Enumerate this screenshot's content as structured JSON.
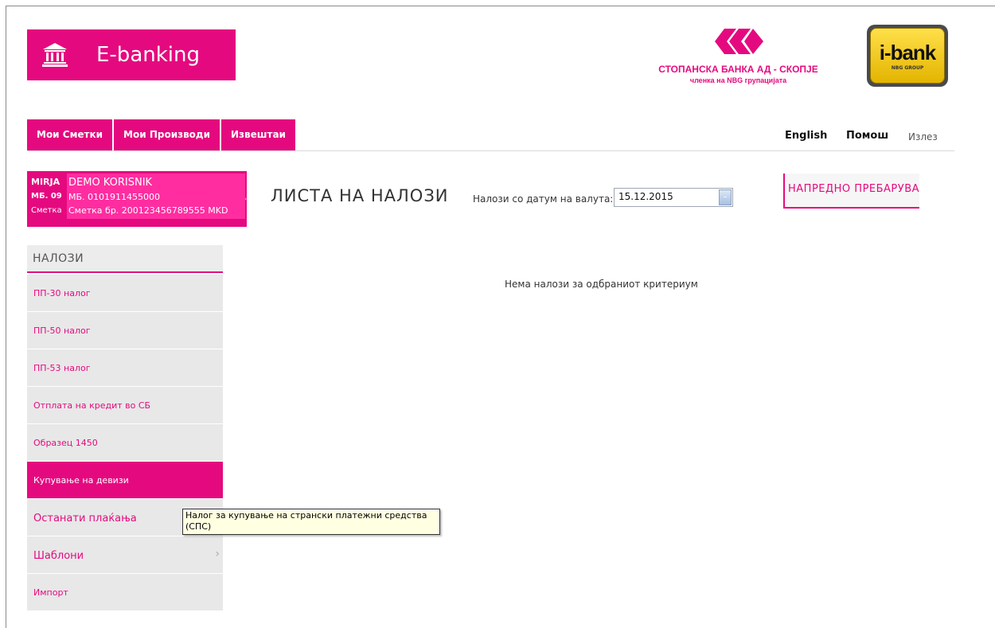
{
  "header": {
    "app_title": "E-banking",
    "bank_name": "СТОПАНСКА БАНКА АД - СКОПЈЕ",
    "bank_subtitle": "членка на NBG групацијата",
    "ibank_label": "i-bank",
    "ibank_sub": "NBG GROUP",
    "brand_color": "#e5097f"
  },
  "nav": {
    "items": [
      "Мои Сметки",
      "Мои Производи",
      "Извештаи"
    ],
    "english": "English",
    "help": "Помош",
    "exit": "Излез"
  },
  "user": {
    "back_name": "MIRJA",
    "back_mb": "МБ. 09",
    "back_account": "Сметка",
    "name": "DEMO KORISNIK",
    "mb": "МБ. 0101911455000",
    "account": "Сметка бр. 200123456789555 MKD"
  },
  "main": {
    "title": "ЛИСТА НА НАЛОЗИ",
    "date_label": "Налози со датум на валута:",
    "date_value": "15.12.2015",
    "advanced_search": "НАПРЕДНО ПРЕБАРУВА",
    "empty_message": "Нема налози за одбраниот критериум"
  },
  "sidebar": {
    "heading": "НАЛОЗИ",
    "items": [
      {
        "label": "ПП-30 налог"
      },
      {
        "label": "ПП-50 налог"
      },
      {
        "label": "ПП-53 налог"
      },
      {
        "label": "Отплата на кредит во СБ"
      },
      {
        "label": "Образец 1450"
      },
      {
        "label": "Купување на девизи"
      },
      {
        "label": "Останати плаќања"
      },
      {
        "label": "Шаблони"
      },
      {
        "label": "Импорт"
      }
    ],
    "active_index": 5
  },
  "tooltip": {
    "text": "Налог за купување на странски платежни средства (СПС)"
  }
}
